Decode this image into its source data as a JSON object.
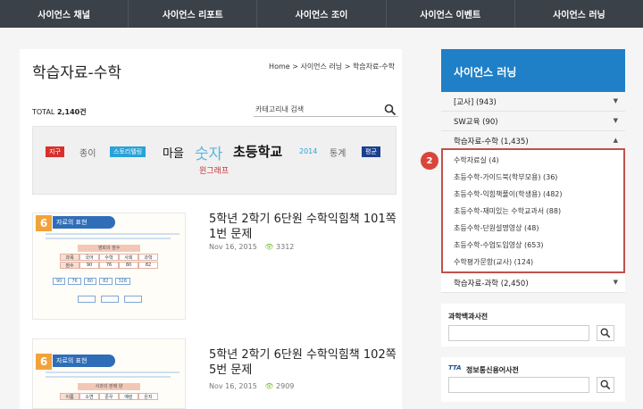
{
  "topnav": {
    "items": [
      "사이언스 채널",
      "사이언스 리포트",
      "사이언스 조이",
      "사이언스 이벤트",
      "사이언스 러닝"
    ]
  },
  "main": {
    "title": "학습자료-수학",
    "breadcrumb": "Home > 사이언스 러닝 > 학습자료-수학",
    "total_label": "TOTAL",
    "total_count": "2,140건",
    "search_placeholder": "카테고리내 검색",
    "tags": {
      "t1": "지구",
      "t2": "종이",
      "t3": "스토리텔링",
      "t4": "마을",
      "t5": "숫자",
      "t6": "초등학교",
      "t7": "2014",
      "t8": "통계",
      "t9": "평균",
      "t10": "윈그래프"
    },
    "posts": [
      {
        "title": "5학년 2학기 6단원 수학익힘책 101쪽 1번 문제",
        "date": "Nov 16, 2015",
        "views": "3312",
        "thumb": {
          "num": "6",
          "heading": "자료의 표현",
          "table_head": "영희의 점수",
          "subjects": [
            "과목",
            "국어",
            "수학",
            "사회",
            "과학"
          ],
          "scores": [
            "점수",
            "90",
            "76",
            "80",
            "82"
          ],
          "sum": [
            "90",
            "76",
            "80",
            "82",
            "328"
          ]
        }
      },
      {
        "title": "5학년 2학기 6단원 수학익힘책 102쪽 5번 문제",
        "date": "Nov 16, 2015",
        "views": "2909",
        "thumb": {
          "num": "6",
          "heading": "자료의 표현",
          "table_head": "사과의 판매 양",
          "subjects": [
            "이름",
            "소연",
            "준우",
            "예린",
            "은지"
          ]
        }
      }
    ]
  },
  "sidebar": {
    "heading": "사이언스 러닝",
    "categories": [
      {
        "label": "[교사] (943)"
      },
      {
        "label": "SW교육 (90)"
      },
      {
        "label": "학습자료-수학 (1,435)"
      }
    ],
    "subitems": [
      "수학자료실 (4)",
      "초등수학-가이드북(학부모용) (36)",
      "초등수학-익힘책풀이(학생용) (482)",
      "초등수학-재미있는 수학교과서 (88)",
      "초등수학-단원설명영상 (48)",
      "초등수학-수업도입영상 (653)",
      "수학평가문항(교사) (124)"
    ],
    "after": {
      "label": "학습자료-과학 (2,450)"
    },
    "marker": "2",
    "widgets": {
      "dict1": "과학백과사전",
      "dict2": "정보통신용어사전",
      "tta": "TTA"
    }
  },
  "colors": {
    "accent": "#1f7fc7",
    "nav": "#3b4149",
    "highlight": "#c1514a"
  }
}
